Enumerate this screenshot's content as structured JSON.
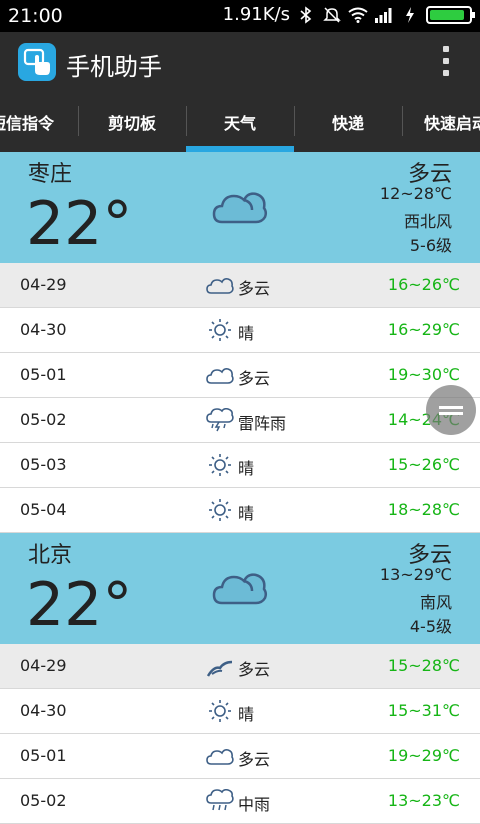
{
  "status_bar": {
    "time": "21:00",
    "network_speed": "1.91K/s"
  },
  "app": {
    "title": "手机助手"
  },
  "tabs": [
    {
      "label": "短信指令"
    },
    {
      "label": "剪切板"
    },
    {
      "label": "天气",
      "active": true
    },
    {
      "label": "快递"
    },
    {
      "label": "快速启动"
    }
  ],
  "cities": [
    {
      "name": "枣庄",
      "temp": "22°",
      "condition": "多云",
      "range": "12~28℃",
      "wind": "西北风",
      "wind_level": "5-6级",
      "forecast": [
        {
          "date": "04-29",
          "icon": "cloud-icon",
          "condition": "多云",
          "range": "16~26℃"
        },
        {
          "date": "04-30",
          "icon": "sun-icon",
          "condition": "晴",
          "range": "16~29℃"
        },
        {
          "date": "05-01",
          "icon": "cloud-icon",
          "condition": "多云",
          "range": "19~30℃"
        },
        {
          "date": "05-02",
          "icon": "thunderstorm-icon",
          "condition": "雷阵雨",
          "range": "14~24℃"
        },
        {
          "date": "05-03",
          "icon": "sun-icon",
          "condition": "晴",
          "range": "15~26℃"
        },
        {
          "date": "05-04",
          "icon": "sun-icon",
          "condition": "晴",
          "range": "18~28℃"
        }
      ]
    },
    {
      "name": "北京",
      "temp": "22°",
      "condition": "多云",
      "range": "13~29℃",
      "wind": "南风",
      "wind_level": "4-5级",
      "forecast": [
        {
          "date": "04-29",
          "icon": "cloud-icon",
          "condition": "多云",
          "range": "15~28℃"
        },
        {
          "date": "04-30",
          "icon": "sun-icon",
          "condition": "晴",
          "range": "15~31℃"
        },
        {
          "date": "05-01",
          "icon": "cloud-icon",
          "condition": "多云",
          "range": "19~29℃"
        },
        {
          "date": "05-02",
          "icon": "rain-icon",
          "condition": "中雨",
          "range": "13~23℃"
        }
      ]
    }
  ],
  "colors": {
    "accent": "#29a7e1",
    "panel": "#7bcbe1",
    "temp_range": "#16b516",
    "bar": "#2c2c2c"
  }
}
